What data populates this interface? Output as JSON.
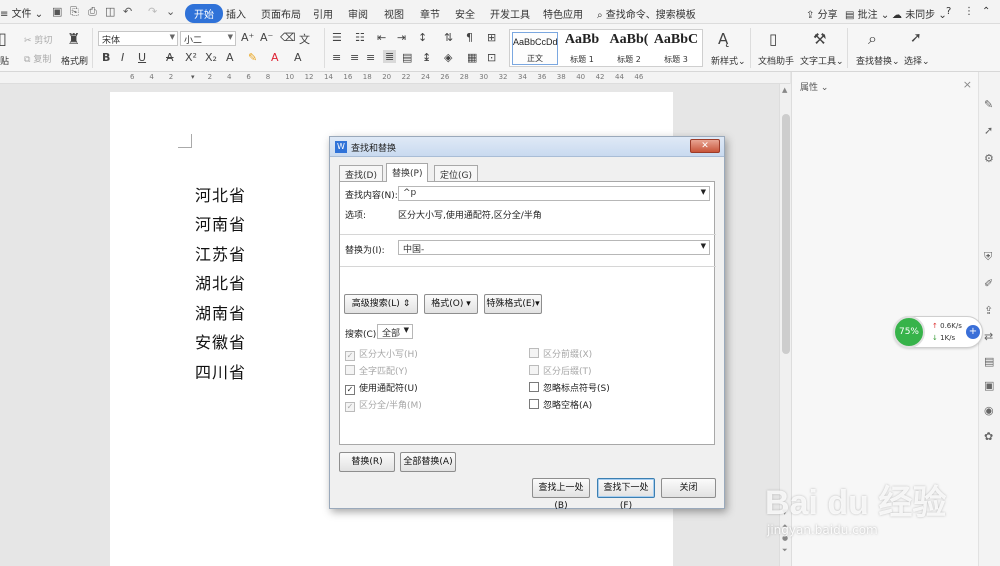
{
  "menubar": {
    "file": "文件",
    "tabs": [
      {
        "label": "开始",
        "active": true
      },
      {
        "label": "插入"
      },
      {
        "label": "页面布局"
      },
      {
        "label": "引用"
      },
      {
        "label": "审阅"
      },
      {
        "label": "视图"
      },
      {
        "label": "章节"
      },
      {
        "label": "安全"
      },
      {
        "label": "开发工具"
      },
      {
        "label": "特色应用"
      }
    ],
    "search_cmd": "查找命令、搜索模板",
    "share": "分享",
    "comment": "批注",
    "sync": "未同步"
  },
  "ribbon": {
    "paste": "贴",
    "cut": "剪切",
    "copy": "复制",
    "format_painter": "格式刷",
    "font_name": "宋体",
    "font_size": "小二",
    "styles": [
      {
        "preview": "AaBbCcDd",
        "name": "正文"
      },
      {
        "preview": "AaBb",
        "name": "标题 1"
      },
      {
        "preview": "AaBb(",
        "name": "标题 2"
      },
      {
        "preview": "AaBbC",
        "name": "标题 3"
      }
    ],
    "new_style": "新样式",
    "doc_assistant": "文档助手",
    "text_tools": "文字工具",
    "find_replace": "查找替换",
    "select": "选择"
  },
  "ruler_ticks": [
    "6",
    "4",
    "2",
    "",
    "2",
    "4",
    "6",
    "8",
    "10",
    "12",
    "14",
    "16",
    "18",
    "20",
    "22",
    "24",
    "26",
    "28",
    "30",
    "32",
    "34",
    "36",
    "38",
    "40",
    "42",
    "44",
    "46"
  ],
  "document": {
    "lines": [
      "河北省",
      "河南省",
      "江苏省",
      "湖北省",
      "湖南省",
      "安徽省",
      "四川省"
    ]
  },
  "properties": {
    "title": "属性"
  },
  "net_widget": {
    "percent": "75%",
    "up": "0.6K/s",
    "down": "1K/s"
  },
  "watermark": {
    "logo": "Bai du 经验",
    "url": "jingyan.baidu.com"
  },
  "dialog": {
    "title": "查找和替换",
    "tabs": [
      "查找(D)",
      "替换(P)",
      "定位(G)"
    ],
    "find_label": "查找内容(N):",
    "find_value": "^p",
    "options_label": "选项:",
    "options_value": "区分大小写,使用通配符,区分全/半角",
    "replace_label": "替换为(I):",
    "replace_value": "中国-",
    "advanced_btn": "高级搜索(L)",
    "format_btn": "格式(O)",
    "special_btn": "特殊格式(E)",
    "search_label": "搜索(C)",
    "search_value": "全部",
    "checks_left": [
      {
        "label": "区分大小写(H)",
        "checked": true,
        "disabled": true
      },
      {
        "label": "全字匹配(Y)",
        "checked": false,
        "disabled": true
      },
      {
        "label": "使用通配符(U)",
        "checked": true,
        "disabled": false
      },
      {
        "label": "区分全/半角(M)",
        "checked": true,
        "disabled": true
      }
    ],
    "checks_right": [
      {
        "label": "区分前缀(X)",
        "checked": false,
        "disabled": true
      },
      {
        "label": "区分后缀(T)",
        "checked": false,
        "disabled": true
      },
      {
        "label": "忽略标点符号(S)",
        "checked": false,
        "disabled": false
      },
      {
        "label": "忽略空格(A)",
        "checked": false,
        "disabled": false
      }
    ],
    "replace_btn": "替换(R)",
    "replace_all_btn": "全部替换(A)",
    "find_prev_btn": "查找上一处(B)",
    "find_next_btn": "查找下一处(F)",
    "close_btn": "关闭"
  }
}
